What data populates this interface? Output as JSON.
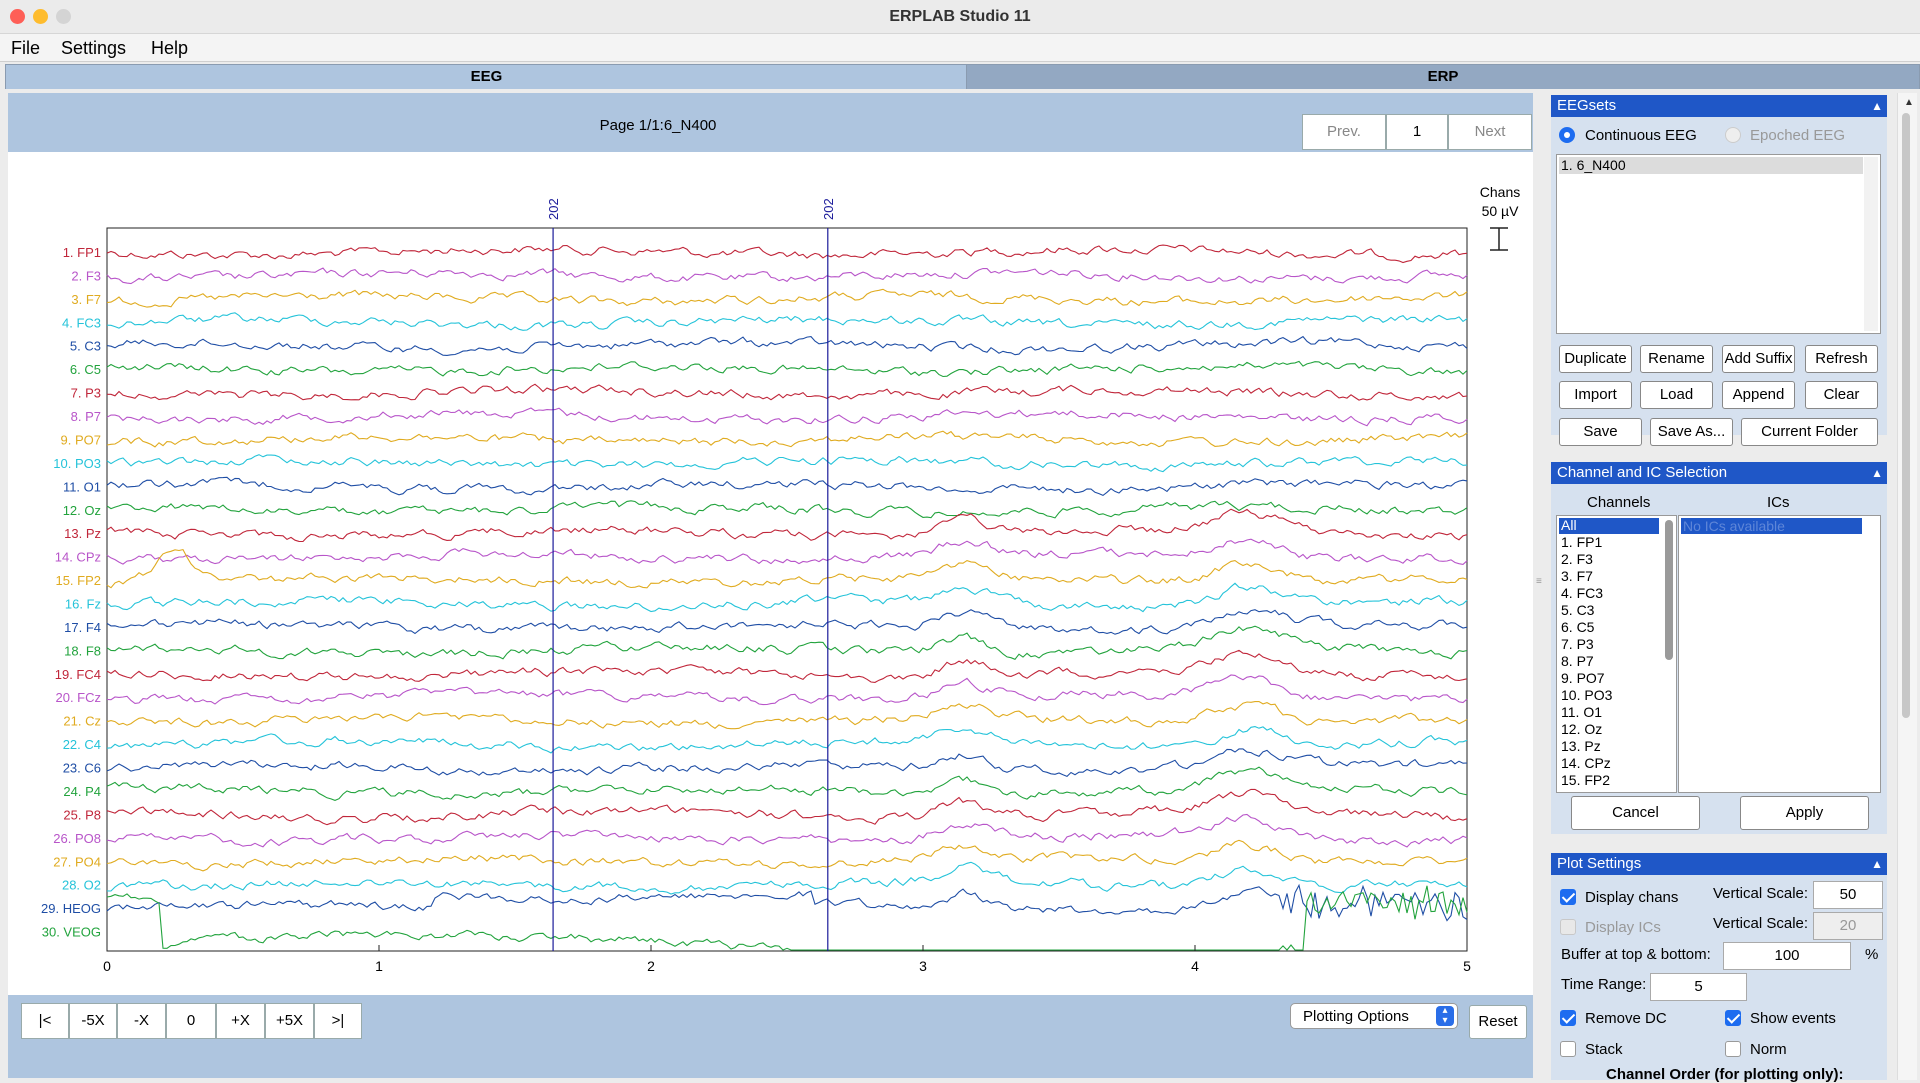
{
  "window": {
    "title": "ERPLAB Studio 11"
  },
  "menu": [
    "File",
    "Settings",
    "Help"
  ],
  "tabs": {
    "eeg": "EEG",
    "erp": "ERP"
  },
  "page": {
    "label": "Page 1/1:6_N400",
    "prev": "Prev.",
    "page_number": "1",
    "next": "Next"
  },
  "plot": {
    "scale_label_chans": "Chans",
    "scale_label_uv": "50 µV",
    "event_markers": [
      {
        "label": "202",
        "time": 1.64
      },
      {
        "label": "202",
        "time": 2.65
      }
    ],
    "x_ticks": [
      "0",
      "1",
      "2",
      "3",
      "4",
      "5"
    ],
    "channels": [
      {
        "label": "1. FP1",
        "color": "#c0263a"
      },
      {
        "label": "2. F3",
        "color": "#b855c9"
      },
      {
        "label": "3. F7",
        "color": "#e0ab20"
      },
      {
        "label": "4. FC3",
        "color": "#25c3d9"
      },
      {
        "label": "5. C3",
        "color": "#1f4ea5"
      },
      {
        "label": "6. C5",
        "color": "#22a33d"
      },
      {
        "label": "7. P3",
        "color": "#c0263a"
      },
      {
        "label": "8. P7",
        "color": "#b855c9"
      },
      {
        "label": "9. PO7",
        "color": "#e0ab20"
      },
      {
        "label": "10. PO3",
        "color": "#25c3d9"
      },
      {
        "label": "11. O1",
        "color": "#1f4ea5"
      },
      {
        "label": "12. Oz",
        "color": "#22a33d"
      },
      {
        "label": "13. Pz",
        "color": "#c0263a"
      },
      {
        "label": "14. CPz",
        "color": "#b855c9"
      },
      {
        "label": "15. FP2",
        "color": "#e0ab20"
      },
      {
        "label": "16. Fz",
        "color": "#25c3d9"
      },
      {
        "label": "17. F4",
        "color": "#1f4ea5"
      },
      {
        "label": "18. F8",
        "color": "#22a33d"
      },
      {
        "label": "19. FC4",
        "color": "#c0263a"
      },
      {
        "label": "20. FCz",
        "color": "#b855c9"
      },
      {
        "label": "21. Cz",
        "color": "#e0ab20"
      },
      {
        "label": "22. C4",
        "color": "#25c3d9"
      },
      {
        "label": "23. C6",
        "color": "#1f4ea5"
      },
      {
        "label": "24. P4",
        "color": "#22a33d"
      },
      {
        "label": "25. P8",
        "color": "#c0263a"
      },
      {
        "label": "26. PO8",
        "color": "#b855c9"
      },
      {
        "label": "27. PO4",
        "color": "#e0ab20"
      },
      {
        "label": "28. O2",
        "color": "#25c3d9"
      },
      {
        "label": "29. HEOG",
        "color": "#1f4ea5"
      },
      {
        "label": "30. VEOG",
        "color": "#22a33d"
      }
    ]
  },
  "nav": {
    "first": "|<",
    "minus5x": "-5X",
    "minusx": "-X",
    "position": "0",
    "plusx": "+X",
    "plus5x": "+5X",
    "last": ">|",
    "plotting_options": "Plotting Options",
    "reset": "Reset"
  },
  "eegsets": {
    "header": "EEGsets",
    "continuous": "Continuous EEG",
    "epoched": "Epoched EEG",
    "items": [
      "1. 6_N400"
    ],
    "buttons": {
      "duplicate": "Duplicate",
      "rename": "Rename",
      "add_suffix": "Add Suffix",
      "refresh": "Refresh",
      "import": "Import",
      "load": "Load",
      "append": "Append",
      "clear": "Clear",
      "save": "Save",
      "save_as": "Save As...",
      "current_folder": "Current Folder"
    }
  },
  "channel_ic": {
    "header": "Channel  and IC Selection",
    "channels_label": "Channels",
    "ics_label": "ICs",
    "channel_items": [
      "All",
      "1. FP1",
      "2. F3",
      "3. F7",
      "4. FC3",
      "5. C3",
      "6. C5",
      "7. P3",
      "8. P7",
      "9. PO7",
      "10. PO3",
      "11. O1",
      "12. Oz",
      "13. Pz",
      "14. CPz",
      "15. FP2"
    ],
    "ic_items": [
      "No ICs available"
    ],
    "cancel": "Cancel",
    "apply": "Apply"
  },
  "plot_settings": {
    "header": "Plot Settings",
    "display_chans": "Display chans",
    "display_ics": "Display ICs",
    "vertical_scale_label": "Vertical Scale:",
    "vertical_scale_chans": "50",
    "vertical_scale_ics": "20",
    "buffer_label": "Buffer at top & bottom:",
    "buffer_value": "100",
    "buffer_unit": "%",
    "time_range_label": "Time Range:",
    "time_range_value": "5",
    "remove_dc": "Remove DC",
    "show_events": "Show events",
    "stack": "Stack",
    "norm": "Norm",
    "channel_order": "Channel Order (for plotting only):"
  }
}
